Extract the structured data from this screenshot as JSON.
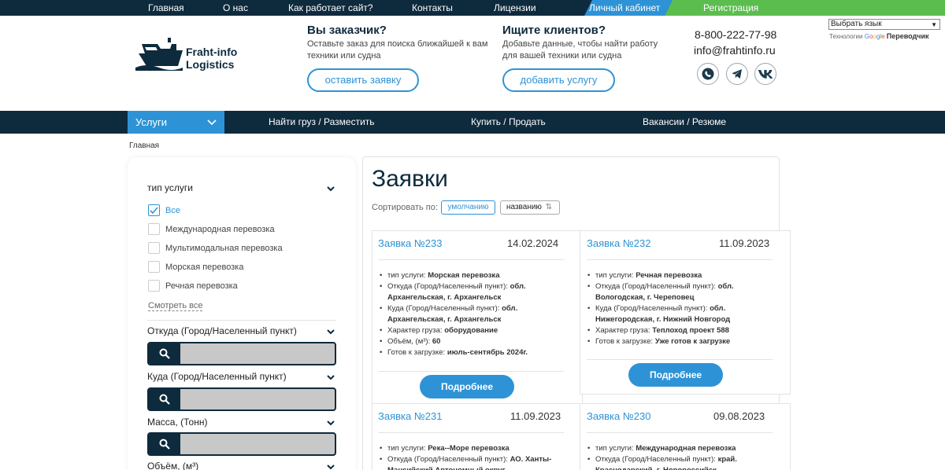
{
  "topnav": {
    "items": [
      "Главная",
      "О нас",
      "Как работает сайт?",
      "Контакты",
      "Лицензии"
    ],
    "cabinet": "Личный кабинет",
    "register": "Регистрация"
  },
  "header": {
    "logo_line1": "Fraht-info",
    "logo_line2": "Logistics",
    "customer_title": "Вы заказчик?",
    "customer_text": "Оставьте заказ для поиска ближайшей к вам техники или судна",
    "customer_button": "оставить заявку",
    "clients_title": "Ищите клиентов?",
    "clients_text": "Добавьте данные, чтобы найти работу для вашей техники или судна",
    "clients_button": "добавить услугу",
    "phone": "8-800-222-77-98",
    "email": "info@frahtinfo.ru",
    "social_icons": [
      "whatsapp-icon",
      "telegram-icon",
      "vk-icon"
    ]
  },
  "translate": {
    "select_label": "Выбрать язык",
    "powered_prefix": "Технологии",
    "powered_brand": "Google",
    "powered_suffix": "Переводчик"
  },
  "mainnav": {
    "services": "Услуги",
    "find_cargo": "Найти груз / Разместить",
    "buy_sell": "Купить / Продать",
    "vacancies": "Вакансии / Резюме"
  },
  "breadcrumb": "Главная",
  "sidebar": {
    "service_type": "тип услуги",
    "options": [
      {
        "label": "Все",
        "checked": true
      },
      {
        "label": "Международная перевозка",
        "checked": false
      },
      {
        "label": "Мультимодальная перевозка",
        "checked": false
      },
      {
        "label": "Морская перевозка",
        "checked": false
      },
      {
        "label": "Речная перевозка",
        "checked": false
      }
    ],
    "show_all": "Смотреть все",
    "from_label": "Откуда (Город/Населенный пункт)",
    "to_label": "Куда (Город/Населенный пункт)",
    "mass_label": "Масса, (Тонн)",
    "volume_label": "Объём, (м³)"
  },
  "main": {
    "title": "Заявки",
    "sort_label": "Сортировать по:",
    "sort_default": "умолчанию",
    "sort_name": "названию",
    "cards": [
      {
        "title": "Заявка №233",
        "date": "14.02.2024",
        "rows": [
          {
            "k": "тип услуги: ",
            "v": "Морская перевозка"
          },
          {
            "k": "Откуда (Город/Населенный пункт): ",
            "v": "обл. Архангельская, г. Архангельск"
          },
          {
            "k": "Куда (Город/Населенный пункт): ",
            "v": "обл. Архангельская, г. Архангельск"
          },
          {
            "k": "Характер груза: ",
            "v": "оборудование"
          },
          {
            "k": "Объём, (м³): ",
            "v": "60"
          },
          {
            "k": "Готов к загрузке: ",
            "v": "июль-сентябрь 2024г."
          }
        ],
        "button": "Подробнее"
      },
      {
        "title": "Заявка №232",
        "date": "11.09.2023",
        "rows": [
          {
            "k": "тип услуги: ",
            "v": "Речная перевозка"
          },
          {
            "k": "Откуда (Город/Населенный пункт): ",
            "v": "обл. Вологодская, г. Череповец"
          },
          {
            "k": "Куда (Город/Населенный пункт): ",
            "v": "обл. Нижегородская, г. Нижний Новгород"
          },
          {
            "k": "Характер груза: ",
            "v": "Теплоход проект 588"
          },
          {
            "k": "Готов к загрузке: ",
            "v": "Уже готов к загрузке"
          }
        ],
        "button": "Подробнее"
      },
      {
        "title": "Заявка №231",
        "date": "11.09.2023",
        "rows": [
          {
            "k": "тип услуги: ",
            "v": "Река--Море перевозка"
          },
          {
            "k": "Откуда (Город/Населенный пункт): ",
            "v": "АО. Ханты-Мансийский Автономный округ"
          }
        ]
      },
      {
        "title": "Заявка №230",
        "date": "09.08.2023",
        "rows": [
          {
            "k": "тип услуги: ",
            "v": "Международная перевозка"
          },
          {
            "k": "Откуда (Город/Населенный пункт): ",
            "v": "край. Краснодарский, г. Новороссийск"
          }
        ]
      }
    ]
  },
  "colors": {
    "navy": "#0e2a3d",
    "accent_blue": "#2e93d6",
    "accent_green": "#5cbd4f"
  }
}
